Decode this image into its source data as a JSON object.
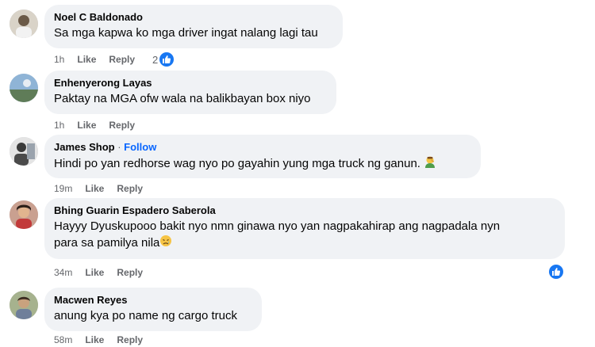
{
  "comments": [
    {
      "author": "Noel C Baldonado",
      "follow": "",
      "text": "Sa mga kapwa ko mga driver ingat nalang lagi tau",
      "time": "1h",
      "like": "Like",
      "reply": "Reply",
      "reactions": "2"
    },
    {
      "author": "Enhenyerong Layas",
      "follow": "",
      "text": "Paktay na MGA ofw wala na balikbayan box niyo",
      "time": "1h",
      "like": "Like",
      "reply": "Reply",
      "reactions": ""
    },
    {
      "author": "James Shop",
      "follow": "Follow",
      "text": "Hindi po yan redhorse wag nyo po gayahin yung mga truck ng ganun.",
      "time": "19m",
      "like": "Like",
      "reply": "Reply",
      "reactions": ""
    },
    {
      "author": "Bhing Guarin Espadero Saberola",
      "follow": "",
      "text": "Hayyy Dyuskupooo bakit nyo nmn ginawa nyo yan nagpakahirap ang nagpadala nyn\npara sa pamilya nila",
      "time": "34m",
      "like": "Like",
      "reply": "Reply",
      "reactions": ""
    },
    {
      "author": "Macwen Reyes",
      "follow": "",
      "text": "anung kya po name ng cargo truck",
      "time": "58m",
      "like": "Like",
      "reply": "Reply",
      "reactions": ""
    }
  ],
  "icons": {
    "like_reaction": "like-icon",
    "emoji_facepalm": "person-facepalming-emoji",
    "emoji_sad": "sad-face-emoji"
  },
  "colors": {
    "like_blue": "#1877f2",
    "follow_blue": "#0866ff",
    "bubble_bg": "#f0f2f5",
    "meta_gray": "#65676b"
  }
}
